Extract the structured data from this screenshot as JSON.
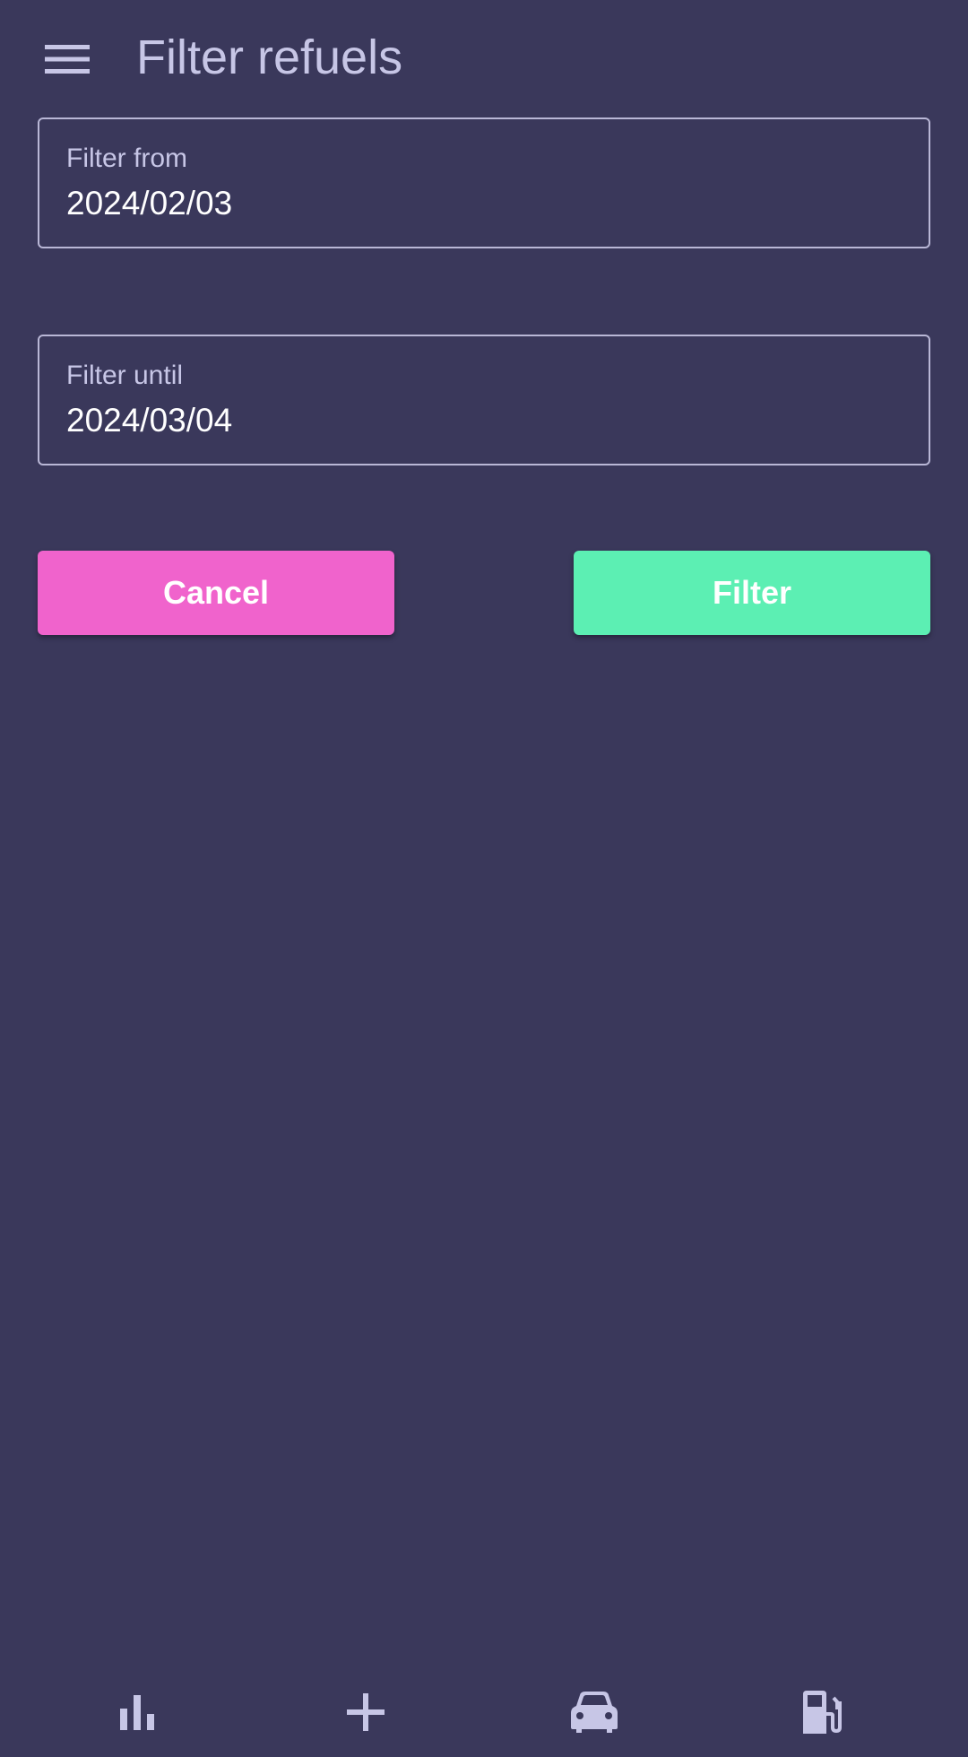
{
  "header": {
    "title": "Filter refuels",
    "menu_icon": "hamburger-menu-icon"
  },
  "form": {
    "from": {
      "label": "Filter from",
      "value": "2024/02/03"
    },
    "until": {
      "label": "Filter until",
      "value": "2024/03/04"
    }
  },
  "actions": {
    "cancel_label": "Cancel",
    "filter_label": "Filter"
  },
  "bottom_nav": {
    "items": [
      {
        "icon": "bar-chart-icon"
      },
      {
        "icon": "plus-icon"
      },
      {
        "icon": "car-icon"
      },
      {
        "icon": "fuel-pump-icon"
      }
    ]
  },
  "colors": {
    "background": "#3a385b",
    "text_muted": "#c7c6e6",
    "cancel": "#f063cc",
    "filter": "#5cefb3"
  }
}
